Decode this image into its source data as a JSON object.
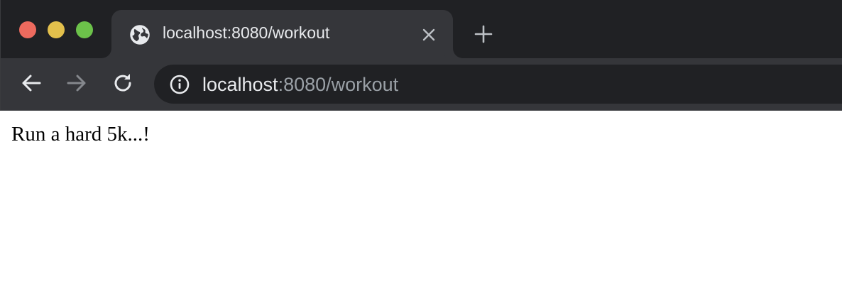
{
  "browser": {
    "tab": {
      "title": "localhost:8080/workout",
      "favicon": "globe-icon"
    },
    "address_bar": {
      "host": "localhost",
      "rest": ":8080/workout"
    },
    "icons": {
      "back": "arrow-left-icon",
      "forward": "arrow-right-icon",
      "reload": "reload-icon",
      "info": "info-icon",
      "close_tab": "close-icon",
      "new_tab": "plus-icon"
    },
    "colors": {
      "chrome_dark": "#202124",
      "chrome_toolbar": "#35363a",
      "text_light": "#e8eaed",
      "text_dim": "#9aa0a6",
      "traffic_close": "#ed6a5e",
      "traffic_minimize": "#e3c04c",
      "traffic_zoom": "#6cc24a"
    }
  },
  "page": {
    "body_text": "Run a hard 5k...!"
  }
}
